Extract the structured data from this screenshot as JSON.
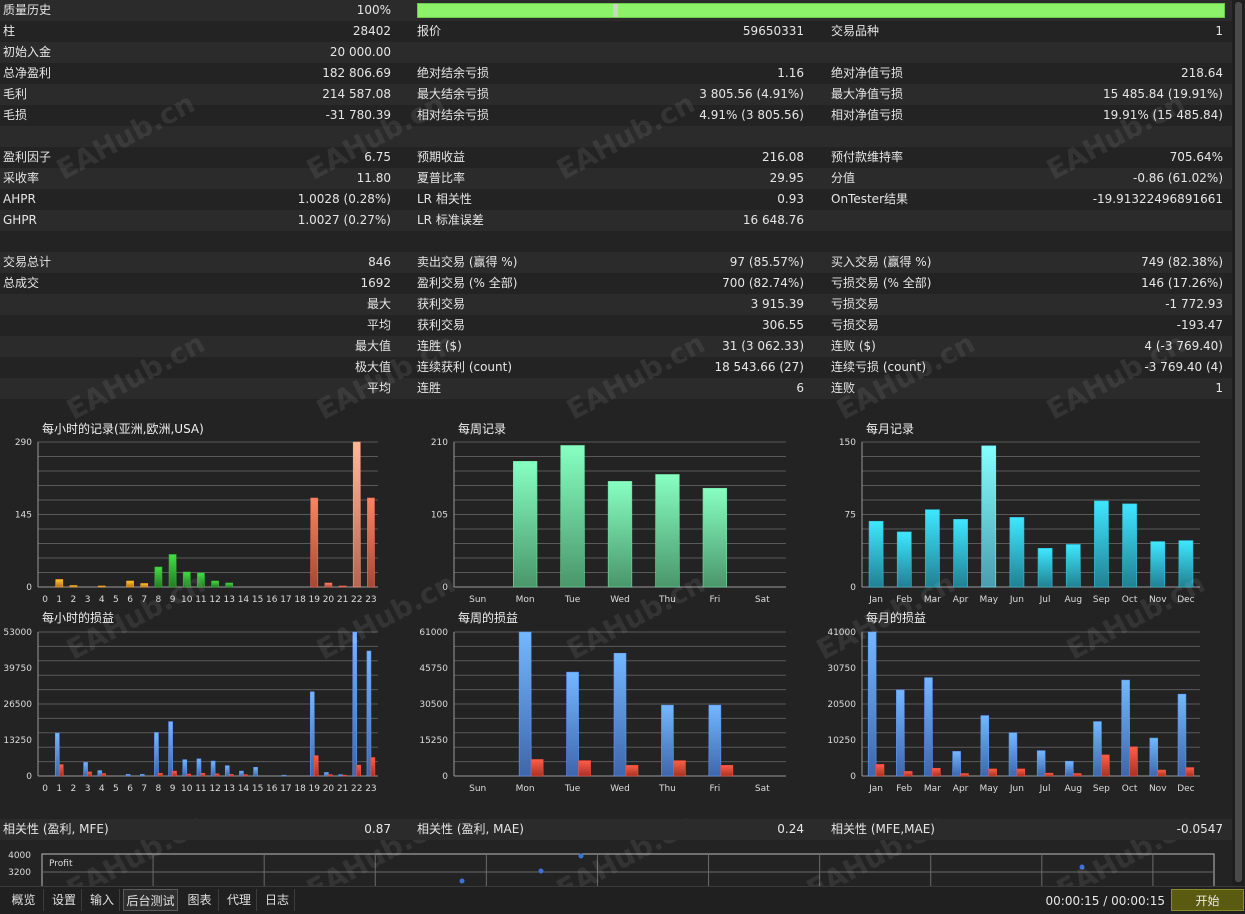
{
  "stats_rows": [
    {
      "cells": [
        [
          "质量历史",
          "100%"
        ]
      ],
      "quality_bar": true
    },
    {
      "cells": [
        [
          "柱",
          "28402"
        ],
        [
          "报价",
          "59650331"
        ],
        [
          "交易品种",
          "1"
        ]
      ]
    },
    {
      "cells": [
        [
          "初始入金",
          "20 000.00"
        ]
      ]
    },
    {
      "cells": [
        [
          "总净盈利",
          "182 806.69"
        ],
        [
          "绝对结余亏损",
          "1.16"
        ],
        [
          "绝对净值亏损",
          "218.64"
        ]
      ]
    },
    {
      "cells": [
        [
          "毛利",
          "214 587.08"
        ],
        [
          "最大结余亏损",
          "3 805.56 (4.91%)"
        ],
        [
          "最大净值亏损",
          "15 485.84 (19.91%)"
        ]
      ]
    },
    {
      "cells": [
        [
          "毛损",
          "-31 780.39"
        ],
        [
          "相对结余亏损",
          "4.91% (3 805.56)"
        ],
        [
          "相对净值亏损",
          "19.91% (15 485.84)"
        ]
      ]
    },
    {
      "cells": []
    },
    {
      "cells": [
        [
          "盈利因子",
          "6.75"
        ],
        [
          "预期收益",
          "216.08"
        ],
        [
          "预付款维持率",
          "705.64%"
        ]
      ]
    },
    {
      "cells": [
        [
          "采收率",
          "11.80"
        ],
        [
          "夏普比率",
          "29.95"
        ],
        [
          "分值",
          "-0.86 (61.02%)"
        ]
      ]
    },
    {
      "cells": [
        [
          "AHPR",
          "1.0028 (0.28%)"
        ],
        [
          "LR 相关性",
          "0.93"
        ],
        [
          "OnTester结果",
          "-19.91322496891661"
        ]
      ]
    },
    {
      "cells": [
        [
          "GHPR",
          "1.0027 (0.27%)"
        ],
        [
          "LR 标准误差",
          "16 648.76"
        ]
      ]
    },
    {
      "cells": []
    },
    {
      "cells": [
        [
          "交易总计",
          "846"
        ],
        [
          "卖出交易 (赢得 %)",
          "97 (85.57%)"
        ],
        [
          "买入交易 (赢得 %)",
          "749 (82.38%)"
        ]
      ]
    },
    {
      "cells": [
        [
          "总成交",
          "1692"
        ],
        [
          "盈利交易 (% 全部)",
          "700 (82.74%)"
        ],
        [
          "亏损交易 (% 全部)",
          "146 (17.26%)"
        ]
      ]
    },
    {
      "cells": [
        [
          "",
          "最大"
        ],
        [
          "获利交易",
          "3 915.39"
        ],
        [
          "亏损交易",
          "-1 772.93"
        ]
      ]
    },
    {
      "cells": [
        [
          "",
          "平均"
        ],
        [
          "获利交易",
          "306.55"
        ],
        [
          "亏损交易",
          "-193.47"
        ]
      ]
    },
    {
      "cells": [
        [
          "",
          "最大值"
        ],
        [
          "连胜 ($)",
          "31 (3 062.33)"
        ],
        [
          "连败 ($)",
          "4 (-3 769.40)"
        ]
      ]
    },
    {
      "cells": [
        [
          "",
          "极大值"
        ],
        [
          "连续获利 (count)",
          "18 543.66 (27)"
        ],
        [
          "连续亏损 (count)",
          "-3 769.40 (4)"
        ]
      ]
    },
    {
      "cells": [
        [
          "",
          "平均"
        ],
        [
          "连胜",
          "6"
        ],
        [
          "连败",
          "1"
        ]
      ]
    }
  ],
  "quality": {
    "value_percent": 100
  },
  "chart_data": [
    {
      "id": "hourly-records",
      "type": "bar",
      "title": "每小时的记录(亚洲,欧洲,USA)",
      "categories": [
        "0",
        "1",
        "2",
        "3",
        "4",
        "5",
        "6",
        "7",
        "8",
        "9",
        "10",
        "11",
        "12",
        "13",
        "14",
        "15",
        "16",
        "17",
        "18",
        "19",
        "20",
        "21",
        "22",
        "23"
      ],
      "yticks": [
        "290",
        "145",
        "0"
      ],
      "ylim": [
        0,
        290
      ],
      "series": [
        {
          "values": [
            0,
            15,
            3,
            0,
            2,
            0,
            12,
            7,
            40,
            65,
            30,
            28,
            12,
            8,
            0,
            0,
            0,
            0,
            0,
            178,
            8,
            2,
            290,
            178
          ]
        }
      ],
      "colors": [
        "#e58a1f",
        "#e58a1f",
        "#e58a1f",
        "#e58a1f",
        "#e58a1f",
        "#e58a1f",
        "#e58a1f",
        "#e58a1f",
        "#2e9a2e",
        "#2e9a2e",
        "#2e9a2e",
        "#2e9a2e",
        "#2e9a2e",
        "#2e9a2e",
        "#2e9a2e",
        "#2e9a2e",
        "#cf5a44",
        "#cf5a44",
        "#cf5a44",
        "#cf5a44",
        "#cf5a44",
        "#cf5a44",
        "#e08068",
        "#cf5a44"
      ]
    },
    {
      "id": "weekly-records",
      "type": "bar",
      "title": "每周记录",
      "categories": [
        "Sun",
        "Mon",
        "Tue",
        "Wed",
        "Thu",
        "Fri",
        "Sat"
      ],
      "yticks": [
        "210",
        "105",
        "0"
      ],
      "ylim": [
        0,
        210
      ],
      "series": [
        {
          "values": [
            0,
            182,
            205,
            153,
            163,
            143,
            0
          ]
        }
      ],
      "colors": [
        "#5dbb86",
        "#5dbb86",
        "#5dbb86",
        "#5dbb86",
        "#5dbb86",
        "#5dbb86",
        "#5dbb86"
      ]
    },
    {
      "id": "monthly-records",
      "type": "bar",
      "title": "每月记录",
      "categories": [
        "Jan",
        "Feb",
        "Mar",
        "Apr",
        "May",
        "Jun",
        "Jul",
        "Aug",
        "Sep",
        "Oct",
        "Nov",
        "Dec"
      ],
      "yticks": [
        "150",
        "75",
        "0"
      ],
      "ylim": [
        0,
        150
      ],
      "series": [
        {
          "values": [
            68,
            57,
            80,
            70,
            146,
            72,
            40,
            44,
            89,
            86,
            47,
            48
          ]
        }
      ],
      "colors": [
        "#2ba0b8",
        "#2ba0b8",
        "#2ba0b8",
        "#2ba0b8",
        "#5cc4dc",
        "#2ba0b8",
        "#2ba0b8",
        "#2ba0b8",
        "#2ba0b8",
        "#2ba0b8",
        "#2ba0b8",
        "#2ba0b8"
      ]
    },
    {
      "id": "hourly-pnl",
      "type": "bar",
      "title": "每小时的损益",
      "categories": [
        "0",
        "1",
        "2",
        "3",
        "4",
        "5",
        "6",
        "7",
        "8",
        "9",
        "10",
        "11",
        "12",
        "13",
        "14",
        "15",
        "16",
        "17",
        "18",
        "19",
        "20",
        "21",
        "22",
        "23"
      ],
      "yticks": [
        "53000",
        "39750",
        "26500",
        "13250",
        "0"
      ],
      "ylim": [
        0,
        53000
      ],
      "series": [
        {
          "values": [
            0,
            15800,
            0,
            5000,
            2000,
            0,
            600,
            600,
            16000,
            20000,
            6000,
            6300,
            5500,
            3800,
            1800,
            3200,
            0,
            300,
            0,
            31000,
            1300,
            500,
            53000,
            46000
          ]
        },
        {
          "values": [
            0,
            4200,
            0,
            1500,
            900,
            0,
            0,
            0,
            1000,
            1800,
            700,
            1000,
            800,
            600,
            500,
            0,
            0,
            0,
            0,
            7500,
            500,
            300,
            4000,
            6800
          ]
        }
      ],
      "colors": [
        "#4f7fd6",
        "#d04030"
      ]
    },
    {
      "id": "weekly-pnl",
      "type": "bar",
      "title": "每周的损益",
      "categories": [
        "Sun",
        "Mon",
        "Tue",
        "Wed",
        "Thu",
        "Fri",
        "Sat"
      ],
      "yticks": [
        "61000",
        "45750",
        "30500",
        "15250",
        "0"
      ],
      "ylim": [
        0,
        61000
      ],
      "series": [
        {
          "values": [
            0,
            61000,
            44000,
            52000,
            30000,
            30000,
            0
          ]
        },
        {
          "values": [
            0,
            7000,
            6500,
            4500,
            6500,
            4500,
            0
          ]
        }
      ],
      "colors": [
        "#4f7fd6",
        "#d04030"
      ]
    },
    {
      "id": "monthly-pnl",
      "type": "bar",
      "title": "每月的损益",
      "categories": [
        "Jan",
        "Feb",
        "Mar",
        "Apr",
        "May",
        "Jun",
        "Jul",
        "Aug",
        "Sep",
        "Oct",
        "Nov",
        "Dec"
      ],
      "yticks": [
        "41000",
        "30750",
        "20500",
        "10250",
        "0"
      ],
      "ylim": [
        0,
        41000
      ],
      "series": [
        {
          "values": [
            41000,
            24500,
            28000,
            7000,
            17200,
            12300,
            7200,
            4200,
            15500,
            27300,
            10800,
            23300
          ]
        },
        {
          "values": [
            3300,
            1300,
            2200,
            700,
            2000,
            2000,
            800,
            700,
            6000,
            8300,
            1700,
            2400
          ]
        }
      ],
      "colors": [
        "#4f7fd6",
        "#d04030"
      ]
    }
  ],
  "correlation": {
    "cells": [
      [
        "相关性 (盈利, MFE)",
        "0.87"
      ],
      [
        "相关性 (盈利, MAE)",
        "0.24"
      ],
      [
        "相关性 (MFE,MAE)",
        "-0.0547"
      ]
    ],
    "scatter": {
      "legend": "Profit",
      "yticks": [
        "4000",
        "3200"
      ]
    }
  },
  "tabs": [
    "概览",
    "设置",
    "输入",
    "后台测试",
    "图表",
    "代理",
    "日志"
  ],
  "active_tab": 3,
  "timer": "00:00:15 / 00:00:15",
  "start_label": "开始",
  "watermark": "EAHub.cn"
}
